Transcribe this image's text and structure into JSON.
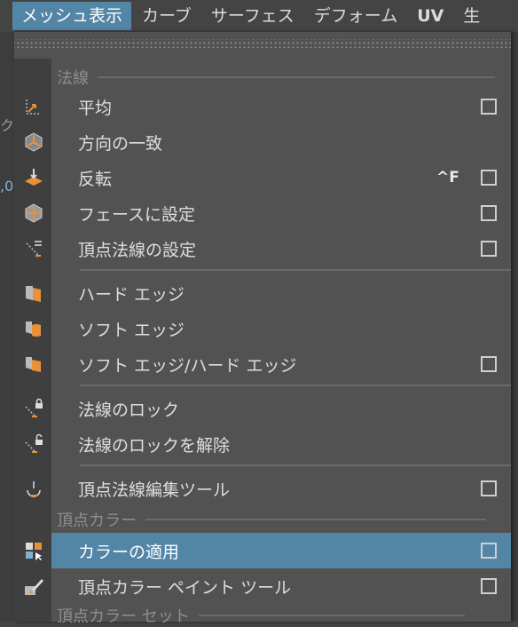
{
  "menubar": {
    "items": [
      {
        "label": "メッシュ表示",
        "active": true
      },
      {
        "label": "カーブ"
      },
      {
        "label": "サーフェス"
      },
      {
        "label": "デフォーム"
      },
      {
        "label": "UV"
      },
      {
        "label": "生"
      }
    ]
  },
  "background": {
    "frag1": "ク",
    "frag2": ",0"
  },
  "menu": {
    "sections": {
      "normals": "法線",
      "vertex_color": "頂点カラー",
      "vertex_color_set": "頂点カラー セット"
    },
    "items": {
      "average": "平均",
      "conform": "方向の一致",
      "reverse": "反転",
      "reverse_shortcut": "^F",
      "set_to_face": "フェースに設定",
      "set_vertex_normal": "頂点法線の設定",
      "hard_edge": "ハード エッジ",
      "soft_edge": "ソフト エッジ",
      "soft_hard_edge": "ソフト エッジ/ハード エッジ",
      "lock_normals": "法線のロック",
      "unlock_normals": "法線のロックを解除",
      "vertex_normal_edit_tool": "頂点法線編集ツール",
      "apply_color": "カラーの適用",
      "paint_vertex_color_tool": "頂点カラー ペイント ツール"
    }
  },
  "colors": {
    "highlight": "#5285a6",
    "accent_orange": "#e8913a",
    "menu_bg": "#525252"
  }
}
